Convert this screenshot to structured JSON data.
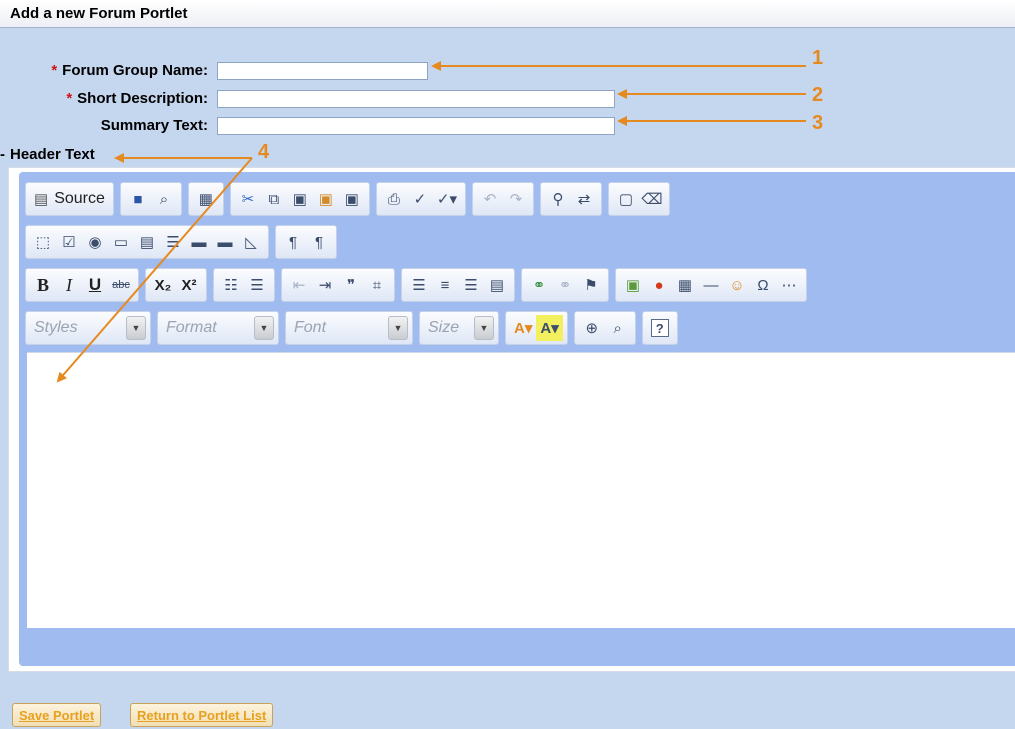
{
  "title": "Add a new Forum Portlet",
  "fields": {
    "group_name": {
      "label": "Forum Group Name:",
      "value": ""
    },
    "short_desc": {
      "label": "Short Description:",
      "value": ""
    },
    "summary": {
      "label": "Summary Text:",
      "value": ""
    }
  },
  "required_mark": "*",
  "header_text": {
    "label": "Header Text",
    "dash": "-"
  },
  "toolbar": {
    "source_label": "Source",
    "bold": "B",
    "italic": "I",
    "underline": "U",
    "strike": "abc",
    "subscript": "X₂",
    "superscript": "X²",
    "styles_placeholder": "Styles",
    "format_placeholder": "Format",
    "font_placeholder": "Font",
    "size_placeholder": "Size",
    "help": "?"
  },
  "buttons": {
    "save": "Save Portlet",
    "return": "Return to Portlet List"
  },
  "callouts": [
    "1",
    "2",
    "3",
    "4"
  ],
  "colors": {
    "callout": "#e58a1f",
    "background": "#c5d6ef",
    "editor": "#9fbbef"
  }
}
